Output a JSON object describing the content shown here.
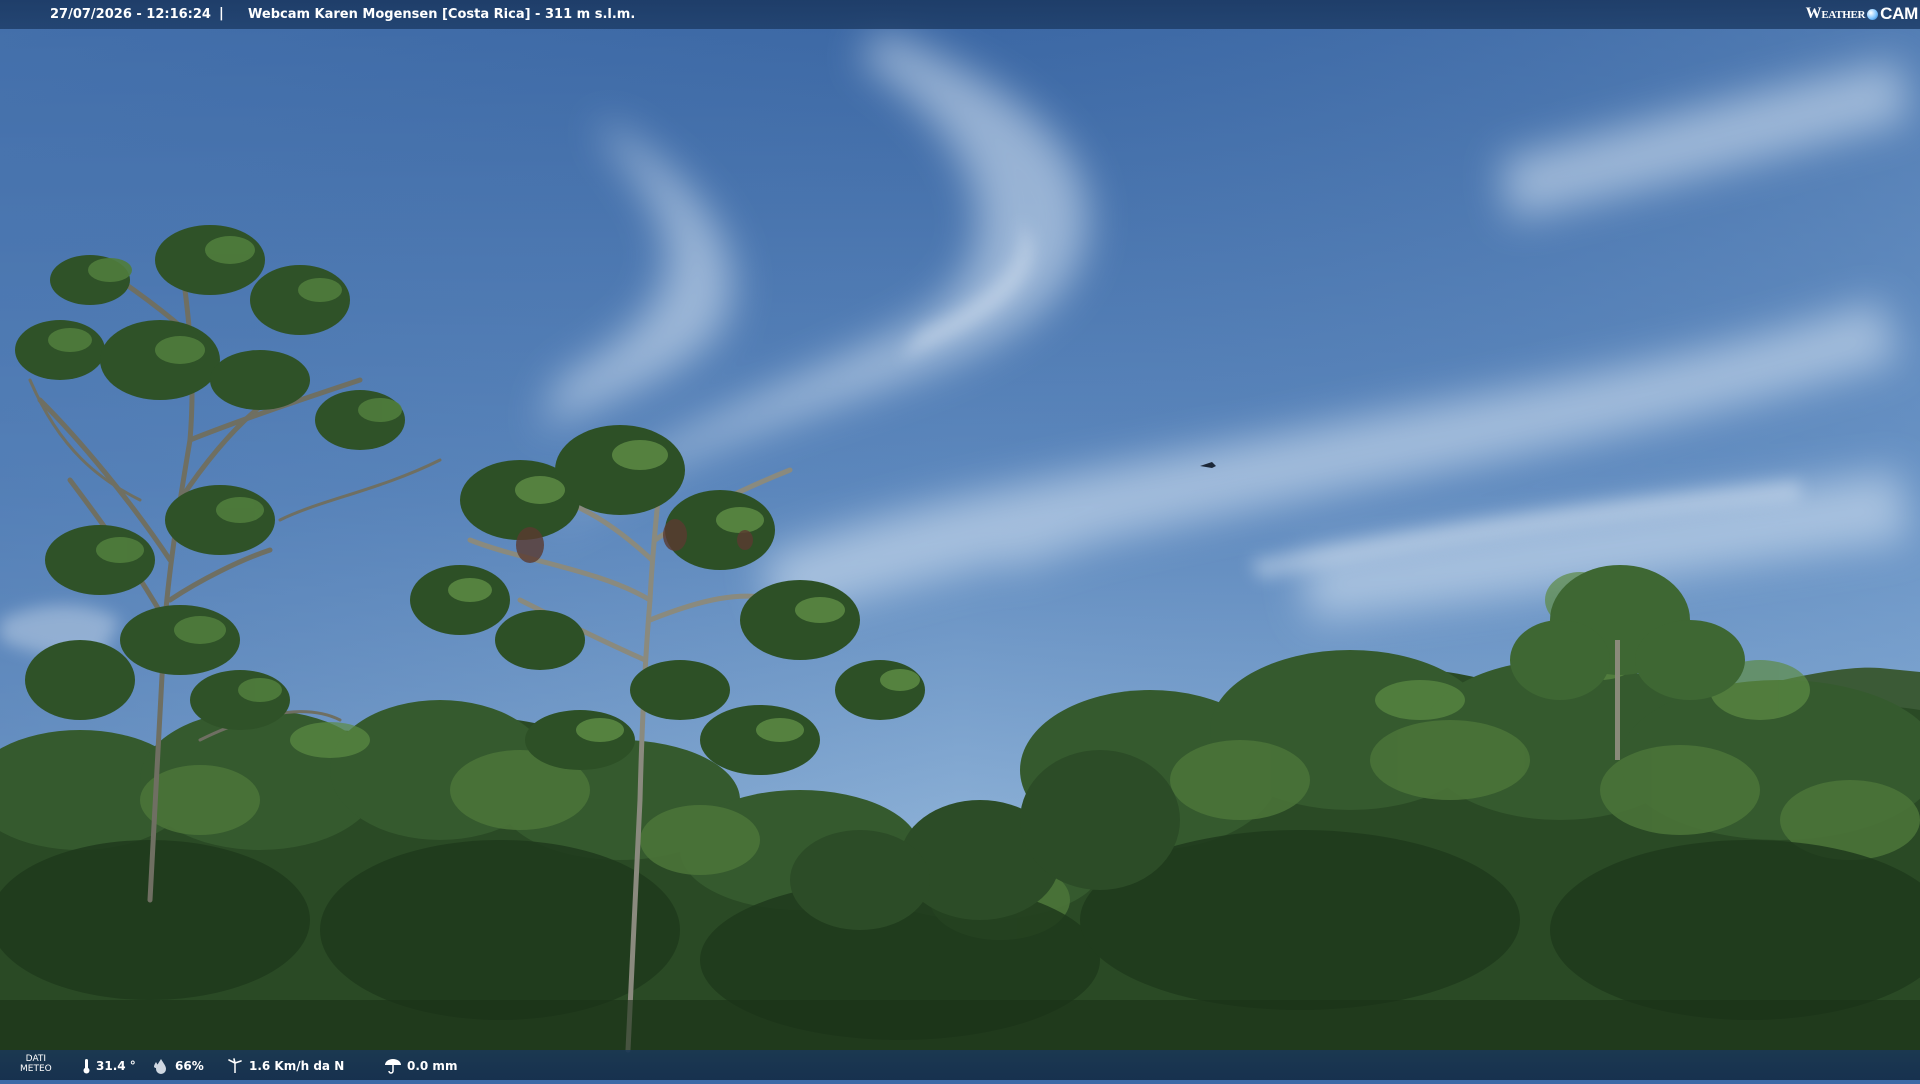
{
  "header": {
    "timestamp": "27/07/2026 - 12:16:24",
    "separator": "|",
    "title": "Webcam Karen Mogensen [Costa Rica] - 311 m s.l.m.",
    "logo_word1": "Weather",
    "logo_word2": "CAM"
  },
  "footer": {
    "label_line1": "DATI",
    "label_line2": "METEO",
    "temperature": "31.4 °",
    "humidity": "66%",
    "wind": "1.6 Km/h da N",
    "rain": "0.0 mm"
  },
  "icons": [
    "thermometer-icon",
    "humidity-icon",
    "wind-icon",
    "rain-icon"
  ],
  "colors": {
    "sky_top": "#3a66a3",
    "sky_bottom": "#8fb3d8",
    "foliage_dark": "#1c3a1a",
    "foliage_light": "#4f7a3a",
    "bar": "#1d3d66"
  }
}
